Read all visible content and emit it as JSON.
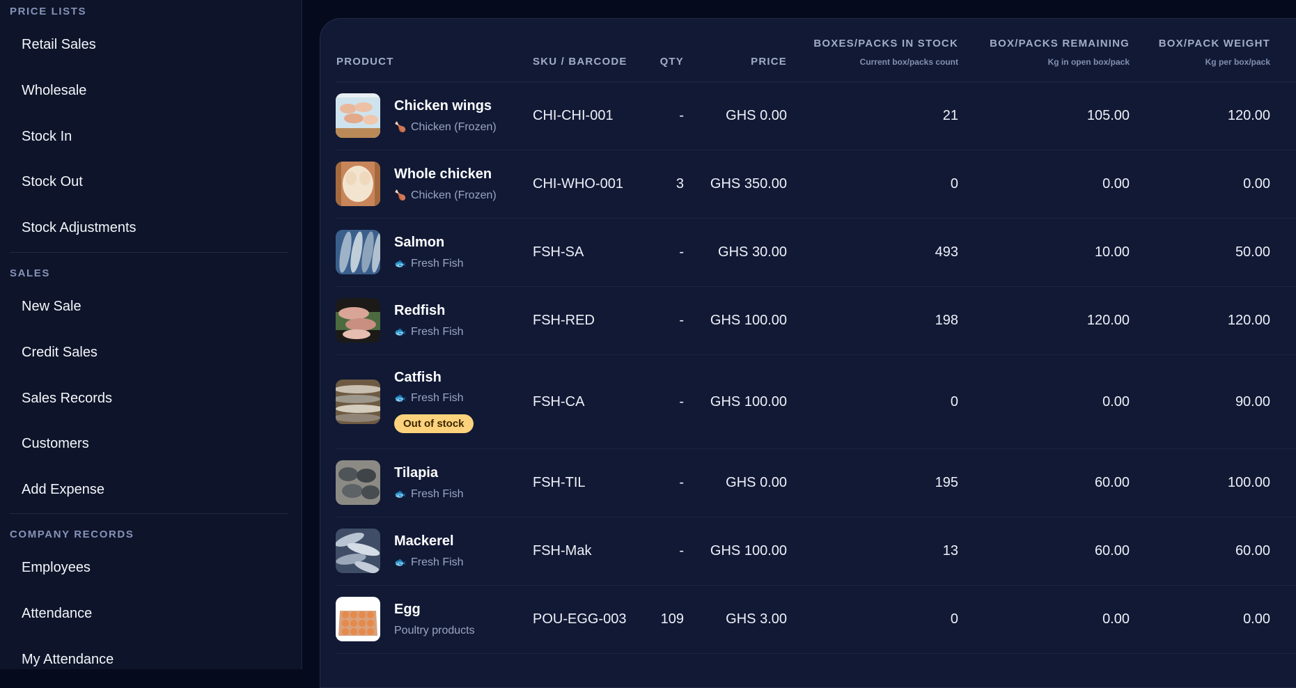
{
  "sidebar": {
    "sections": [
      {
        "title": "PRICE LISTS",
        "items": [
          "Retail Sales",
          "Wholesale",
          "Stock In",
          "Stock Out",
          "Stock Adjustments"
        ]
      },
      {
        "title": "SALES",
        "items": [
          "New Sale",
          "Credit Sales",
          "Sales Records",
          "Customers",
          "Add Expense"
        ]
      },
      {
        "title": "COMPANY RECORDS",
        "items": [
          "Employees",
          "Attendance",
          "My Attendance"
        ]
      }
    ]
  },
  "table": {
    "headers": {
      "product": "PRODUCT",
      "sku": "SKU / BARCODE",
      "qty": "QTY",
      "price": "PRICE",
      "boxes": "BOXES/PACKS IN STOCK",
      "boxes_sub": "Current box/packs count",
      "remaining": "BOX/PACKS REMAINING",
      "remaining_sub": "Kg in open box/pack",
      "weight": "BOX/PACK WEIGHT",
      "weight_sub": "Kg per box/pack"
    },
    "rows": [
      {
        "name": "Chicken wings",
        "category": "Chicken (Frozen)",
        "category_icon": "drumstick-icon",
        "sku": "CHI-CHI-001",
        "qty": "-",
        "price": "GHS 0.00",
        "boxes": "21",
        "remaining": "105.00",
        "weight": "120.00",
        "badge": ""
      },
      {
        "name": "Whole chicken",
        "category": "Chicken (Frozen)",
        "category_icon": "drumstick-icon",
        "sku": "CHI-WHO-001",
        "qty": "3",
        "price": "GHS 350.00",
        "boxes": "0",
        "remaining": "0.00",
        "weight": "0.00",
        "badge": ""
      },
      {
        "name": "Salmon",
        "category": "Fresh Fish",
        "category_icon": "fish-icon",
        "sku": "FSH-SA",
        "qty": "-",
        "price": "GHS 30.00",
        "boxes": "493",
        "remaining": "10.00",
        "weight": "50.00",
        "badge": ""
      },
      {
        "name": "Redfish",
        "category": "Fresh Fish",
        "category_icon": "fish-icon",
        "sku": "FSH-RED",
        "qty": "-",
        "price": "GHS 100.00",
        "boxes": "198",
        "remaining": "120.00",
        "weight": "120.00",
        "badge": ""
      },
      {
        "name": "Catfish",
        "category": "Fresh Fish",
        "category_icon": "fish-icon",
        "sku": "FSH-CA",
        "qty": "-",
        "price": "GHS 100.00",
        "boxes": "0",
        "remaining": "0.00",
        "weight": "90.00",
        "badge": "Out of stock"
      },
      {
        "name": "Tilapia",
        "category": "Fresh Fish",
        "category_icon": "fish-icon",
        "sku": "FSH-TIL",
        "qty": "-",
        "price": "GHS 0.00",
        "boxes": "195",
        "remaining": "60.00",
        "weight": "100.00",
        "badge": ""
      },
      {
        "name": "Mackerel",
        "category": "Fresh Fish",
        "category_icon": "fish-icon",
        "sku": "FSH-Mak",
        "qty": "-",
        "price": "GHS 100.00",
        "boxes": "13",
        "remaining": "60.00",
        "weight": "60.00",
        "badge": ""
      },
      {
        "name": "Egg",
        "category": "Poultry products",
        "category_icon": "",
        "sku": "POU-EGG-003",
        "qty": "109",
        "price": "GHS 3.00",
        "boxes": "0",
        "remaining": "0.00",
        "weight": "0.00",
        "badge": ""
      }
    ]
  },
  "colors": {
    "page_bg": "#050a1d",
    "sidebar_bg": "#0e1429",
    "panel_bg": "#111935",
    "badge_bg": "#fcd37c",
    "badge_text": "#3d2500"
  }
}
